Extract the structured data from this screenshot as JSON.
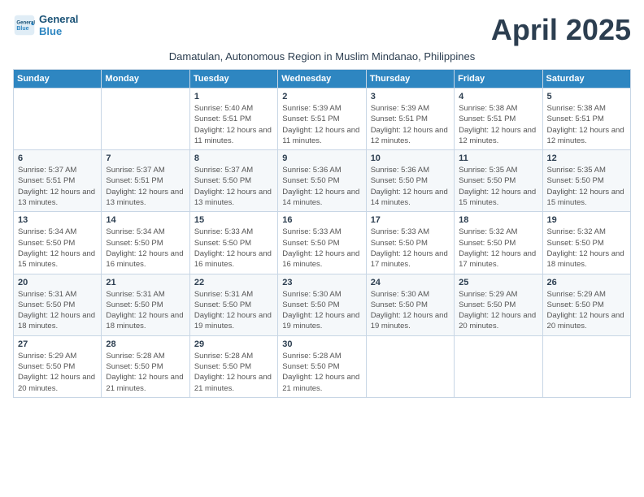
{
  "logo": {
    "line1": "General",
    "line2": "Blue"
  },
  "title": "April 2025",
  "subtitle": "Damatulan, Autonomous Region in Muslim Mindanao, Philippines",
  "weekdays": [
    "Sunday",
    "Monday",
    "Tuesday",
    "Wednesday",
    "Thursday",
    "Friday",
    "Saturday"
  ],
  "weeks": [
    [
      {
        "day": "",
        "sunrise": "",
        "sunset": "",
        "daylight": ""
      },
      {
        "day": "",
        "sunrise": "",
        "sunset": "",
        "daylight": ""
      },
      {
        "day": "1",
        "sunrise": "Sunrise: 5:40 AM",
        "sunset": "Sunset: 5:51 PM",
        "daylight": "Daylight: 12 hours and 11 minutes."
      },
      {
        "day": "2",
        "sunrise": "Sunrise: 5:39 AM",
        "sunset": "Sunset: 5:51 PM",
        "daylight": "Daylight: 12 hours and 11 minutes."
      },
      {
        "day": "3",
        "sunrise": "Sunrise: 5:39 AM",
        "sunset": "Sunset: 5:51 PM",
        "daylight": "Daylight: 12 hours and 12 minutes."
      },
      {
        "day": "4",
        "sunrise": "Sunrise: 5:38 AM",
        "sunset": "Sunset: 5:51 PM",
        "daylight": "Daylight: 12 hours and 12 minutes."
      },
      {
        "day": "5",
        "sunrise": "Sunrise: 5:38 AM",
        "sunset": "Sunset: 5:51 PM",
        "daylight": "Daylight: 12 hours and 12 minutes."
      }
    ],
    [
      {
        "day": "6",
        "sunrise": "Sunrise: 5:37 AM",
        "sunset": "Sunset: 5:51 PM",
        "daylight": "Daylight: 12 hours and 13 minutes."
      },
      {
        "day": "7",
        "sunrise": "Sunrise: 5:37 AM",
        "sunset": "Sunset: 5:51 PM",
        "daylight": "Daylight: 12 hours and 13 minutes."
      },
      {
        "day": "8",
        "sunrise": "Sunrise: 5:37 AM",
        "sunset": "Sunset: 5:50 PM",
        "daylight": "Daylight: 12 hours and 13 minutes."
      },
      {
        "day": "9",
        "sunrise": "Sunrise: 5:36 AM",
        "sunset": "Sunset: 5:50 PM",
        "daylight": "Daylight: 12 hours and 14 minutes."
      },
      {
        "day": "10",
        "sunrise": "Sunrise: 5:36 AM",
        "sunset": "Sunset: 5:50 PM",
        "daylight": "Daylight: 12 hours and 14 minutes."
      },
      {
        "day": "11",
        "sunrise": "Sunrise: 5:35 AM",
        "sunset": "Sunset: 5:50 PM",
        "daylight": "Daylight: 12 hours and 15 minutes."
      },
      {
        "day": "12",
        "sunrise": "Sunrise: 5:35 AM",
        "sunset": "Sunset: 5:50 PM",
        "daylight": "Daylight: 12 hours and 15 minutes."
      }
    ],
    [
      {
        "day": "13",
        "sunrise": "Sunrise: 5:34 AM",
        "sunset": "Sunset: 5:50 PM",
        "daylight": "Daylight: 12 hours and 15 minutes."
      },
      {
        "day": "14",
        "sunrise": "Sunrise: 5:34 AM",
        "sunset": "Sunset: 5:50 PM",
        "daylight": "Daylight: 12 hours and 16 minutes."
      },
      {
        "day": "15",
        "sunrise": "Sunrise: 5:33 AM",
        "sunset": "Sunset: 5:50 PM",
        "daylight": "Daylight: 12 hours and 16 minutes."
      },
      {
        "day": "16",
        "sunrise": "Sunrise: 5:33 AM",
        "sunset": "Sunset: 5:50 PM",
        "daylight": "Daylight: 12 hours and 16 minutes."
      },
      {
        "day": "17",
        "sunrise": "Sunrise: 5:33 AM",
        "sunset": "Sunset: 5:50 PM",
        "daylight": "Daylight: 12 hours and 17 minutes."
      },
      {
        "day": "18",
        "sunrise": "Sunrise: 5:32 AM",
        "sunset": "Sunset: 5:50 PM",
        "daylight": "Daylight: 12 hours and 17 minutes."
      },
      {
        "day": "19",
        "sunrise": "Sunrise: 5:32 AM",
        "sunset": "Sunset: 5:50 PM",
        "daylight": "Daylight: 12 hours and 18 minutes."
      }
    ],
    [
      {
        "day": "20",
        "sunrise": "Sunrise: 5:31 AM",
        "sunset": "Sunset: 5:50 PM",
        "daylight": "Daylight: 12 hours and 18 minutes."
      },
      {
        "day": "21",
        "sunrise": "Sunrise: 5:31 AM",
        "sunset": "Sunset: 5:50 PM",
        "daylight": "Daylight: 12 hours and 18 minutes."
      },
      {
        "day": "22",
        "sunrise": "Sunrise: 5:31 AM",
        "sunset": "Sunset: 5:50 PM",
        "daylight": "Daylight: 12 hours and 19 minutes."
      },
      {
        "day": "23",
        "sunrise": "Sunrise: 5:30 AM",
        "sunset": "Sunset: 5:50 PM",
        "daylight": "Daylight: 12 hours and 19 minutes."
      },
      {
        "day": "24",
        "sunrise": "Sunrise: 5:30 AM",
        "sunset": "Sunset: 5:50 PM",
        "daylight": "Daylight: 12 hours and 19 minutes."
      },
      {
        "day": "25",
        "sunrise": "Sunrise: 5:29 AM",
        "sunset": "Sunset: 5:50 PM",
        "daylight": "Daylight: 12 hours and 20 minutes."
      },
      {
        "day": "26",
        "sunrise": "Sunrise: 5:29 AM",
        "sunset": "Sunset: 5:50 PM",
        "daylight": "Daylight: 12 hours and 20 minutes."
      }
    ],
    [
      {
        "day": "27",
        "sunrise": "Sunrise: 5:29 AM",
        "sunset": "Sunset: 5:50 PM",
        "daylight": "Daylight: 12 hours and 20 minutes."
      },
      {
        "day": "28",
        "sunrise": "Sunrise: 5:28 AM",
        "sunset": "Sunset: 5:50 PM",
        "daylight": "Daylight: 12 hours and 21 minutes."
      },
      {
        "day": "29",
        "sunrise": "Sunrise: 5:28 AM",
        "sunset": "Sunset: 5:50 PM",
        "daylight": "Daylight: 12 hours and 21 minutes."
      },
      {
        "day": "30",
        "sunrise": "Sunrise: 5:28 AM",
        "sunset": "Sunset: 5:50 PM",
        "daylight": "Daylight: 12 hours and 21 minutes."
      },
      {
        "day": "",
        "sunrise": "",
        "sunset": "",
        "daylight": ""
      },
      {
        "day": "",
        "sunrise": "",
        "sunset": "",
        "daylight": ""
      },
      {
        "day": "",
        "sunrise": "",
        "sunset": "",
        "daylight": ""
      }
    ]
  ]
}
